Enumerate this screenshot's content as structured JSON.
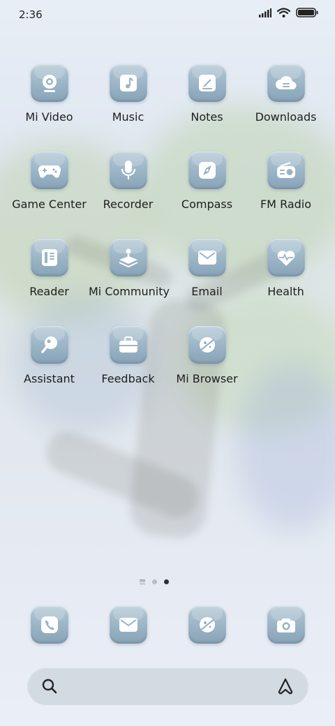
{
  "status_bar": {
    "time": "2:36"
  },
  "apps": [
    {
      "label": "Mi Video"
    },
    {
      "label": "Music"
    },
    {
      "label": "Notes"
    },
    {
      "label": "Downloads"
    },
    {
      "label": "Game Center"
    },
    {
      "label": "Recorder"
    },
    {
      "label": "Compass"
    },
    {
      "label": "FM Radio"
    },
    {
      "label": "Reader"
    },
    {
      "label": "Mi Community"
    },
    {
      "label": "Email"
    },
    {
      "label": "Health"
    },
    {
      "label": "Assistant"
    },
    {
      "label": "Feedback"
    },
    {
      "label": "Mi Browser"
    }
  ],
  "page_indicator": {
    "pages": 2,
    "current": 2
  },
  "dock": [
    "phone-icon",
    "messages-icon",
    "browser-icon",
    "camera-icon"
  ],
  "search_bar": {
    "left_icon": "search-icon",
    "right_icon": "assistant-a-icon"
  }
}
